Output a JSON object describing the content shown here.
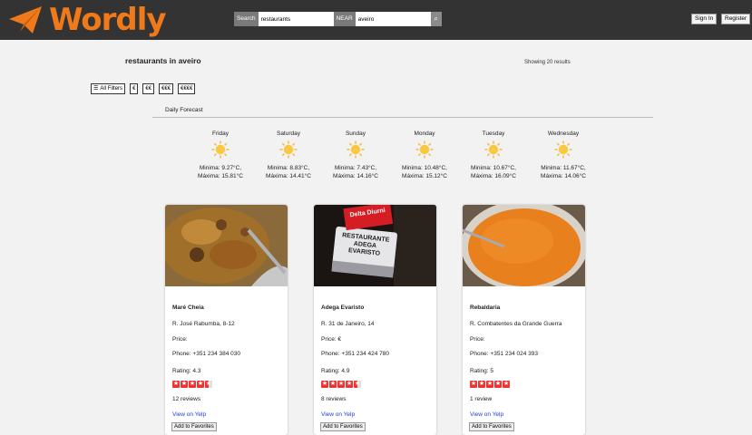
{
  "header": {
    "logo_text": "Wordly",
    "brand_color": "#f07a1a",
    "search_label": "Search",
    "search_value": "restaurants",
    "near_label": "NEAR",
    "near_value": "aveiro",
    "submit_icon": "search-icon",
    "sign_in": "Sign In",
    "register": "Register"
  },
  "results": {
    "title": "restaurants in aveiro",
    "count_text": "Showing 20 results"
  },
  "filters": {
    "all_filters": "All Filters",
    "price_levels": [
      "€",
      "€€",
      "€€€",
      "€€€€"
    ]
  },
  "forecast": {
    "title": "Daily Forecast",
    "days": [
      {
        "name": "Friday",
        "min": "Minima: 9.27°C,",
        "max": "Máxima: 15.81°C",
        "icon": "sun-icon"
      },
      {
        "name": "Saturday",
        "min": "Minima: 8.83°C,",
        "max": "Máxima: 14.41°C",
        "icon": "sun-icon"
      },
      {
        "name": "Sunday",
        "min": "Minima: 7.43°C,",
        "max": "Máxima: 14.16°C",
        "icon": "sun-icon"
      },
      {
        "name": "Monday",
        "min": "Minima: 10.48°C,",
        "max": "Máxima: 15.12°C",
        "icon": "sun-icon"
      },
      {
        "name": "Tuesday",
        "min": "Minima: 10.67°C,",
        "max": "Máxima: 16.09°C",
        "icon": "sun-icon"
      },
      {
        "name": "Wednesday",
        "min": "Minima: 11.67°C,",
        "max": "Máxima: 14.06°C",
        "icon": "sun-icon"
      }
    ]
  },
  "restaurants": [
    {
      "name": "Maré Cheia",
      "address": "R. José Rabumba, 8-12",
      "price": "Price:",
      "phone": "Phone: +351 234 384 030",
      "rating_text": "Rating: 4.3",
      "rating": 4.3,
      "reviews": "12 reviews",
      "yelp_link": "View on Yelp",
      "favorite": "Add to Favorites"
    },
    {
      "name": "Adega Evaristo",
      "address": "R. 31 de Janeiro, 14",
      "price": "Price: €",
      "phone": "Phone: +351 234 424 780",
      "rating_text": "Rating: 4.9",
      "rating": 4.9,
      "reviews": "8 reviews",
      "yelp_link": "View on Yelp",
      "favorite": "Add to Favorites",
      "photo_sign_top": "Delta Diurni",
      "photo_sign_lines": [
        "RESTAURANTE",
        "ADEGA",
        "EVARISTO"
      ]
    },
    {
      "name": "Rebaldaria",
      "address": "R. Combatentes da Grande Guerra",
      "price": "Price:",
      "phone": "Phone: +351 234 024 393",
      "rating_text": "Rating: 5",
      "rating": 5,
      "reviews": "1 review",
      "yelp_link": "View on Yelp",
      "favorite": "Add to Favorites"
    }
  ]
}
